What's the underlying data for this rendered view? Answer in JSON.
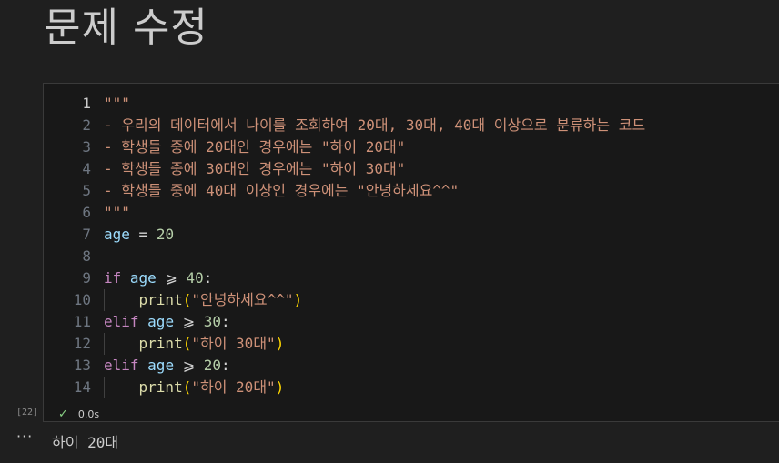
{
  "markdown": {
    "title": "문제 수정"
  },
  "cell": {
    "execution_count": "[22]",
    "status_icon": "check-icon",
    "duration": "0.0s",
    "lines": [
      {
        "num": "1",
        "tokens": [
          {
            "t": "\"\"\"",
            "c": "str"
          }
        ]
      },
      {
        "num": "2",
        "tokens": [
          {
            "t": "- 우리의 데이터에서 나이를 조회하여 20대, 30대, 40대 이상으로 분류하는 코드",
            "c": "str"
          }
        ]
      },
      {
        "num": "3",
        "tokens": [
          {
            "t": "- 학생들 중에 20대인 경우에는 \"하이 20대\"",
            "c": "str"
          }
        ]
      },
      {
        "num": "4",
        "tokens": [
          {
            "t": "- 학생들 중에 30대인 경우에는 \"하이 30대\"",
            "c": "str"
          }
        ]
      },
      {
        "num": "5",
        "tokens": [
          {
            "t": "- 학생들 중에 40대 이상인 경우에는 \"안녕하세요^^\"",
            "c": "str"
          }
        ]
      },
      {
        "num": "6",
        "tokens": [
          {
            "t": "\"\"\"",
            "c": "str"
          }
        ]
      },
      {
        "num": "7",
        "tokens": [
          {
            "t": "age",
            "c": "var"
          },
          {
            "t": " = ",
            "c": "op"
          },
          {
            "t": "20",
            "c": "num"
          }
        ]
      },
      {
        "num": "8",
        "tokens": []
      },
      {
        "num": "9",
        "tokens": [
          {
            "t": "if",
            "c": "kw"
          },
          {
            "t": " ",
            "c": "op"
          },
          {
            "t": "age",
            "c": "var"
          },
          {
            "t": " ⩾ ",
            "c": "op"
          },
          {
            "t": "40",
            "c": "num"
          },
          {
            "t": ":",
            "c": "op"
          }
        ]
      },
      {
        "num": "10",
        "tokens": [
          {
            "t": "    ",
            "c": "op"
          },
          {
            "t": "print",
            "c": "fn"
          },
          {
            "t": "(",
            "c": "pn"
          },
          {
            "t": "\"안녕하세요^^\"",
            "c": "str"
          },
          {
            "t": ")",
            "c": "pn"
          }
        ]
      },
      {
        "num": "11",
        "tokens": [
          {
            "t": "elif",
            "c": "kw"
          },
          {
            "t": " ",
            "c": "op"
          },
          {
            "t": "age",
            "c": "var"
          },
          {
            "t": " ⩾ ",
            "c": "op"
          },
          {
            "t": "30",
            "c": "num"
          },
          {
            "t": ":",
            "c": "op"
          }
        ]
      },
      {
        "num": "12",
        "tokens": [
          {
            "t": "    ",
            "c": "op"
          },
          {
            "t": "print",
            "c": "fn"
          },
          {
            "t": "(",
            "c": "pn"
          },
          {
            "t": "\"하이 30대\"",
            "c": "str"
          },
          {
            "t": ")",
            "c": "pn"
          }
        ]
      },
      {
        "num": "13",
        "tokens": [
          {
            "t": "elif",
            "c": "kw"
          },
          {
            "t": " ",
            "c": "op"
          },
          {
            "t": "age",
            "c": "var"
          },
          {
            "t": " ⩾ ",
            "c": "op"
          },
          {
            "t": "20",
            "c": "num"
          },
          {
            "t": ":",
            "c": "op"
          }
        ]
      },
      {
        "num": "14",
        "tokens": [
          {
            "t": "    ",
            "c": "op"
          },
          {
            "t": "print",
            "c": "fn"
          },
          {
            "t": "(",
            "c": "pn"
          },
          {
            "t": "\"하이 20대\"",
            "c": "str"
          },
          {
            "t": ")",
            "c": "pn"
          }
        ]
      }
    ]
  },
  "output": {
    "menu_icon": "ellipsis-icon",
    "menu_glyph": "···",
    "text": "하이 20대"
  },
  "colors": {
    "background": "#1f1f1f",
    "editor_background": "#181818",
    "string": "#ce9178",
    "variable": "#9cdcfe",
    "number": "#b5cea8",
    "keyword": "#c586c0",
    "function": "#dcdcaa",
    "bracket": "#ffd700",
    "success": "#89d185"
  }
}
